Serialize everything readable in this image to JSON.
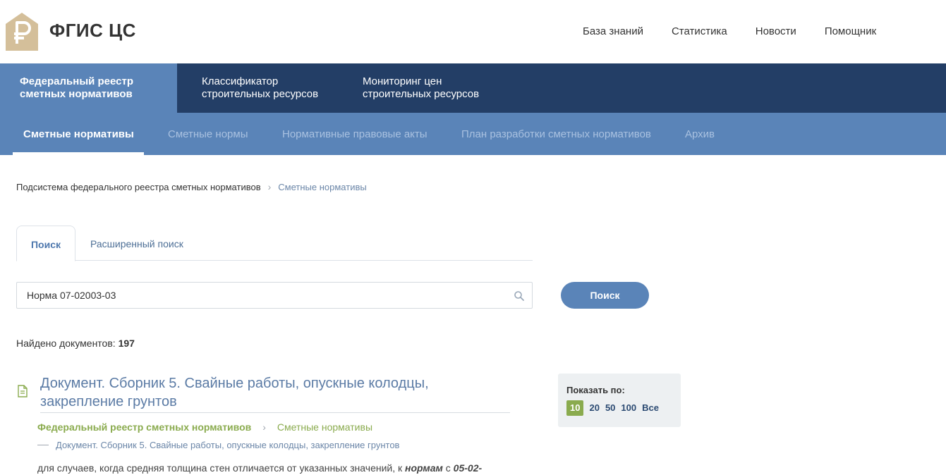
{
  "header": {
    "brand": "ФГИС ЦС",
    "logo_icon": "ruble-house-icon",
    "nav": [
      "База знаний",
      "Статистика",
      "Новости",
      "Помощник"
    ]
  },
  "main_nav": [
    {
      "line1": "Федеральный реестр",
      "line2": "сметных нормативов"
    },
    {
      "line1": "Классификатор",
      "line2": "строительных ресурсов"
    },
    {
      "line1": "Мониторинг цен",
      "line2": "строительных ресурсов"
    }
  ],
  "sub_nav": [
    "Сметные нормативы",
    "Сметные нормы",
    "Нормативные правовые акты",
    "План разработки сметных нормативов",
    "Архив"
  ],
  "breadcrumb": {
    "root": "Подсистема федерального реестра сметных нормативов",
    "current": "Сметные нормативы"
  },
  "tabs": {
    "search": "Поиск",
    "advanced": "Расширенный поиск"
  },
  "search": {
    "value": "Норма 07-02003-03",
    "button": "Поиск"
  },
  "found": {
    "label": "Найдено документов:",
    "count": "197"
  },
  "result": {
    "title": "Документ. Сборник 5. Свайные работы, опускные колодцы, закрепление грунтов",
    "path1": "Федеральный реестр сметных нормативов",
    "path2": "Сметные нормативы",
    "sub": "Документ. Сборник 5. Свайные работы, опускные колодцы, закрепление грунтов",
    "snippet_pre": "для случаев, когда средняя толщина стен отличается от указанных значений, к ",
    "snippet_bold1": "нормам",
    "snippet_mid": " с ",
    "snippet_bold2": "05-02-"
  },
  "page_size": {
    "label": "Показать по:",
    "options": [
      "10",
      "20",
      "50",
      "100",
      "Все"
    ],
    "selected": "10"
  },
  "colors": {
    "dark_nav": "#233e66",
    "accent": "#5a84b8",
    "green": "#8aab4e"
  }
}
